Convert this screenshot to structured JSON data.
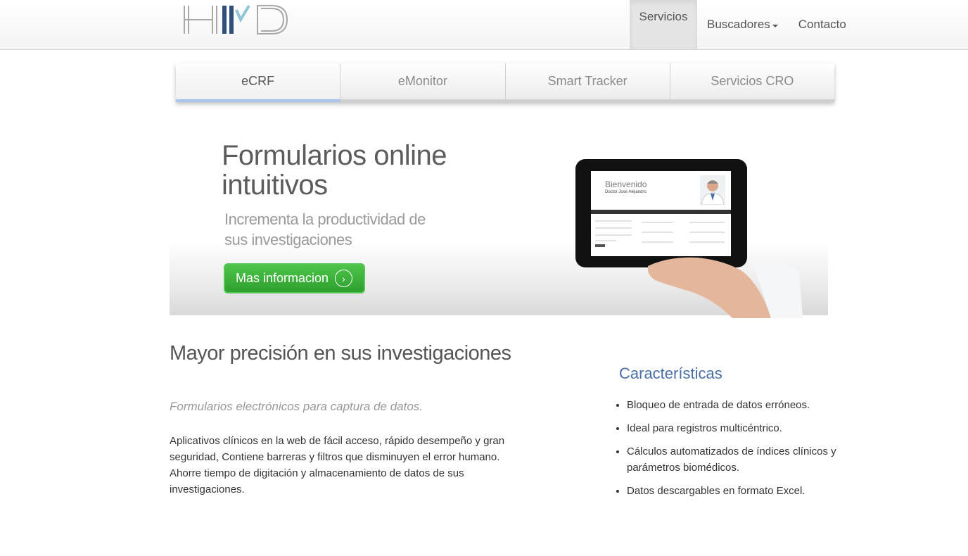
{
  "navbar": {
    "logo_text": "HMD",
    "items": [
      {
        "label": "Servicios"
      },
      {
        "label": "Buscadores"
      },
      {
        "label": "Contacto"
      }
    ]
  },
  "tabs": [
    {
      "label": "eCRF"
    },
    {
      "label": "eMonitor"
    },
    {
      "label": "Smart Tracker"
    },
    {
      "label": "Servicios CRO"
    }
  ],
  "hero": {
    "title": "Formularios online intuitivos",
    "subtitle": "Incrementa la productividad de sus investigaciones",
    "button_label": "Mas informacion",
    "tablet": {
      "welcome": "Bienvenido",
      "doctor": "Doctor Jose Alejandro"
    }
  },
  "content": {
    "title": "Mayor precisión en sus investigaciones",
    "lead": "Formularios electrónicos para captura de datos.",
    "body": "Aplicativos clínicos en la web de fácil acceso, rápido desempeño y gran seguridad, Contiene barreras y filtros que disminuyen el error humano. Ahorre tiempo de digitación y almacenamiento de datos de sus investigaciones."
  },
  "features": {
    "title": "Características",
    "items": [
      "Bloqueo de entrada de datos erróneos.",
      "Ideal para registros multicéntrico.",
      "Cálculos automatizados de índices clínicos y parámetros biomédicos.",
      "Datos descargables en formato Excel."
    ]
  },
  "colors": {
    "accent_blue": "#4a6fa5",
    "button_green": "#3cb43a",
    "tab_active_border": "#a9c6ee"
  }
}
